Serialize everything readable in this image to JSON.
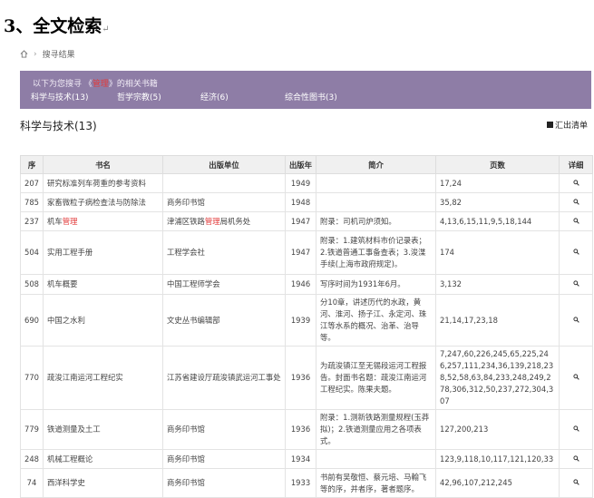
{
  "heading": "3、全文检索",
  "heading_mark": "↵",
  "breadcrumb": {
    "home_icon": "home-icon",
    "separator": "›",
    "current": "搜寻结果"
  },
  "banner": {
    "intro_prefix": "以下为您搜寻 《",
    "keyword": "管理",
    "intro_suffix": "》的相关书籍",
    "categories": [
      {
        "label": "科学与技术(13)"
      },
      {
        "label": "哲学宗教(5)"
      },
      {
        "label": "经济(6)"
      },
      {
        "label": "综合性图书(3)"
      }
    ],
    "bg_color": "#8e7da6"
  },
  "section": {
    "title": "科学与技术(13)",
    "export_label": "汇出清单"
  },
  "table": {
    "headers": [
      "序",
      "书名",
      "出版单位",
      "出版年",
      "简介",
      "页数",
      "详细"
    ],
    "rows": [
      {
        "id": "207",
        "title": "研究标准列车荷重的参考资料",
        "publisher": "",
        "year": "1949",
        "intro": "",
        "pages": "17,24",
        "h": 21
      },
      {
        "id": "785",
        "title": "家畜微粒子病检查法与防除法",
        "publisher": "商务印书馆",
        "year": "1948",
        "intro": "",
        "pages": "35,82",
        "h": 21
      },
      {
        "id": "237",
        "title_prefix": "机车",
        "title_hl": "管理",
        "publisher_prefix": "津浦区铁路",
        "publisher_hl": "管理",
        "publisher_suffix": "局机务处",
        "year": "1947",
        "intro": "附录：司机司炉须知。",
        "pages": "4,13,6,15,11,9,5,18,144",
        "h": 21
      },
      {
        "id": "504",
        "title": "实用工程手册",
        "publisher": "工程学会社",
        "year": "1947",
        "intro": "附录：1.建筑材料市价记录表；2.铁道普通工事备查表；3.浚渫手续(上海市政府规定)。",
        "pages": "174",
        "h": 48
      },
      {
        "id": "508",
        "title": "机车概要",
        "publisher": "中国工程师学会",
        "year": "1946",
        "intro": "写序时间为1931年6月。",
        "pages": "3,132",
        "h": 22
      },
      {
        "id": "690",
        "title": "中国之水利",
        "publisher": "文史丛书编辑部",
        "year": "1939",
        "intro": "分10章，讲述历代的水政，黄河、淮河、扬子江、永定河、珠江等水系的概况、治革、治导等。",
        "pages": "21,14,17,23,18",
        "h": 46
      },
      {
        "id": "770",
        "title": "疏浚江南运河工程纪实",
        "publisher": "江苏省建设厅疏浚镇武运河工事处",
        "year": "1936",
        "intro": "为疏浚镇江至无锡段运河工程报告。封面书名题：疏浚江南运河工程纪实。陈果夫题。",
        "pages": "7,247,60,226,245,65,225,246,257,111,234,36,139,218,238,52,58,63,84,233,248,249,278,306,312,50,237,272,304,307",
        "h": 61
      },
      {
        "id": "779",
        "title": "铁道测量及土工",
        "publisher": "商务印书馆",
        "year": "1936",
        "intro": "附录：1.测新铁路测量规程(玉莽拟)；2.铁道测量应用之各项表式。",
        "pages": "127,200,213",
        "h": 32
      },
      {
        "id": "248",
        "title": "机械工程概论",
        "publisher": "商务印书馆",
        "year": "1934",
        "intro": "",
        "pages": "123,9,118,10,117,121,120,33",
        "h": 21
      },
      {
        "id": "74",
        "title": "西洋科学史",
        "publisher": "商务印书馆",
        "year": "1933",
        "intro": "书前有吴敬恒、蔡元培、马翰飞等的序，并者序，著者题序。",
        "pages": "42,96,107,212,245",
        "h": 32
      }
    ]
  }
}
